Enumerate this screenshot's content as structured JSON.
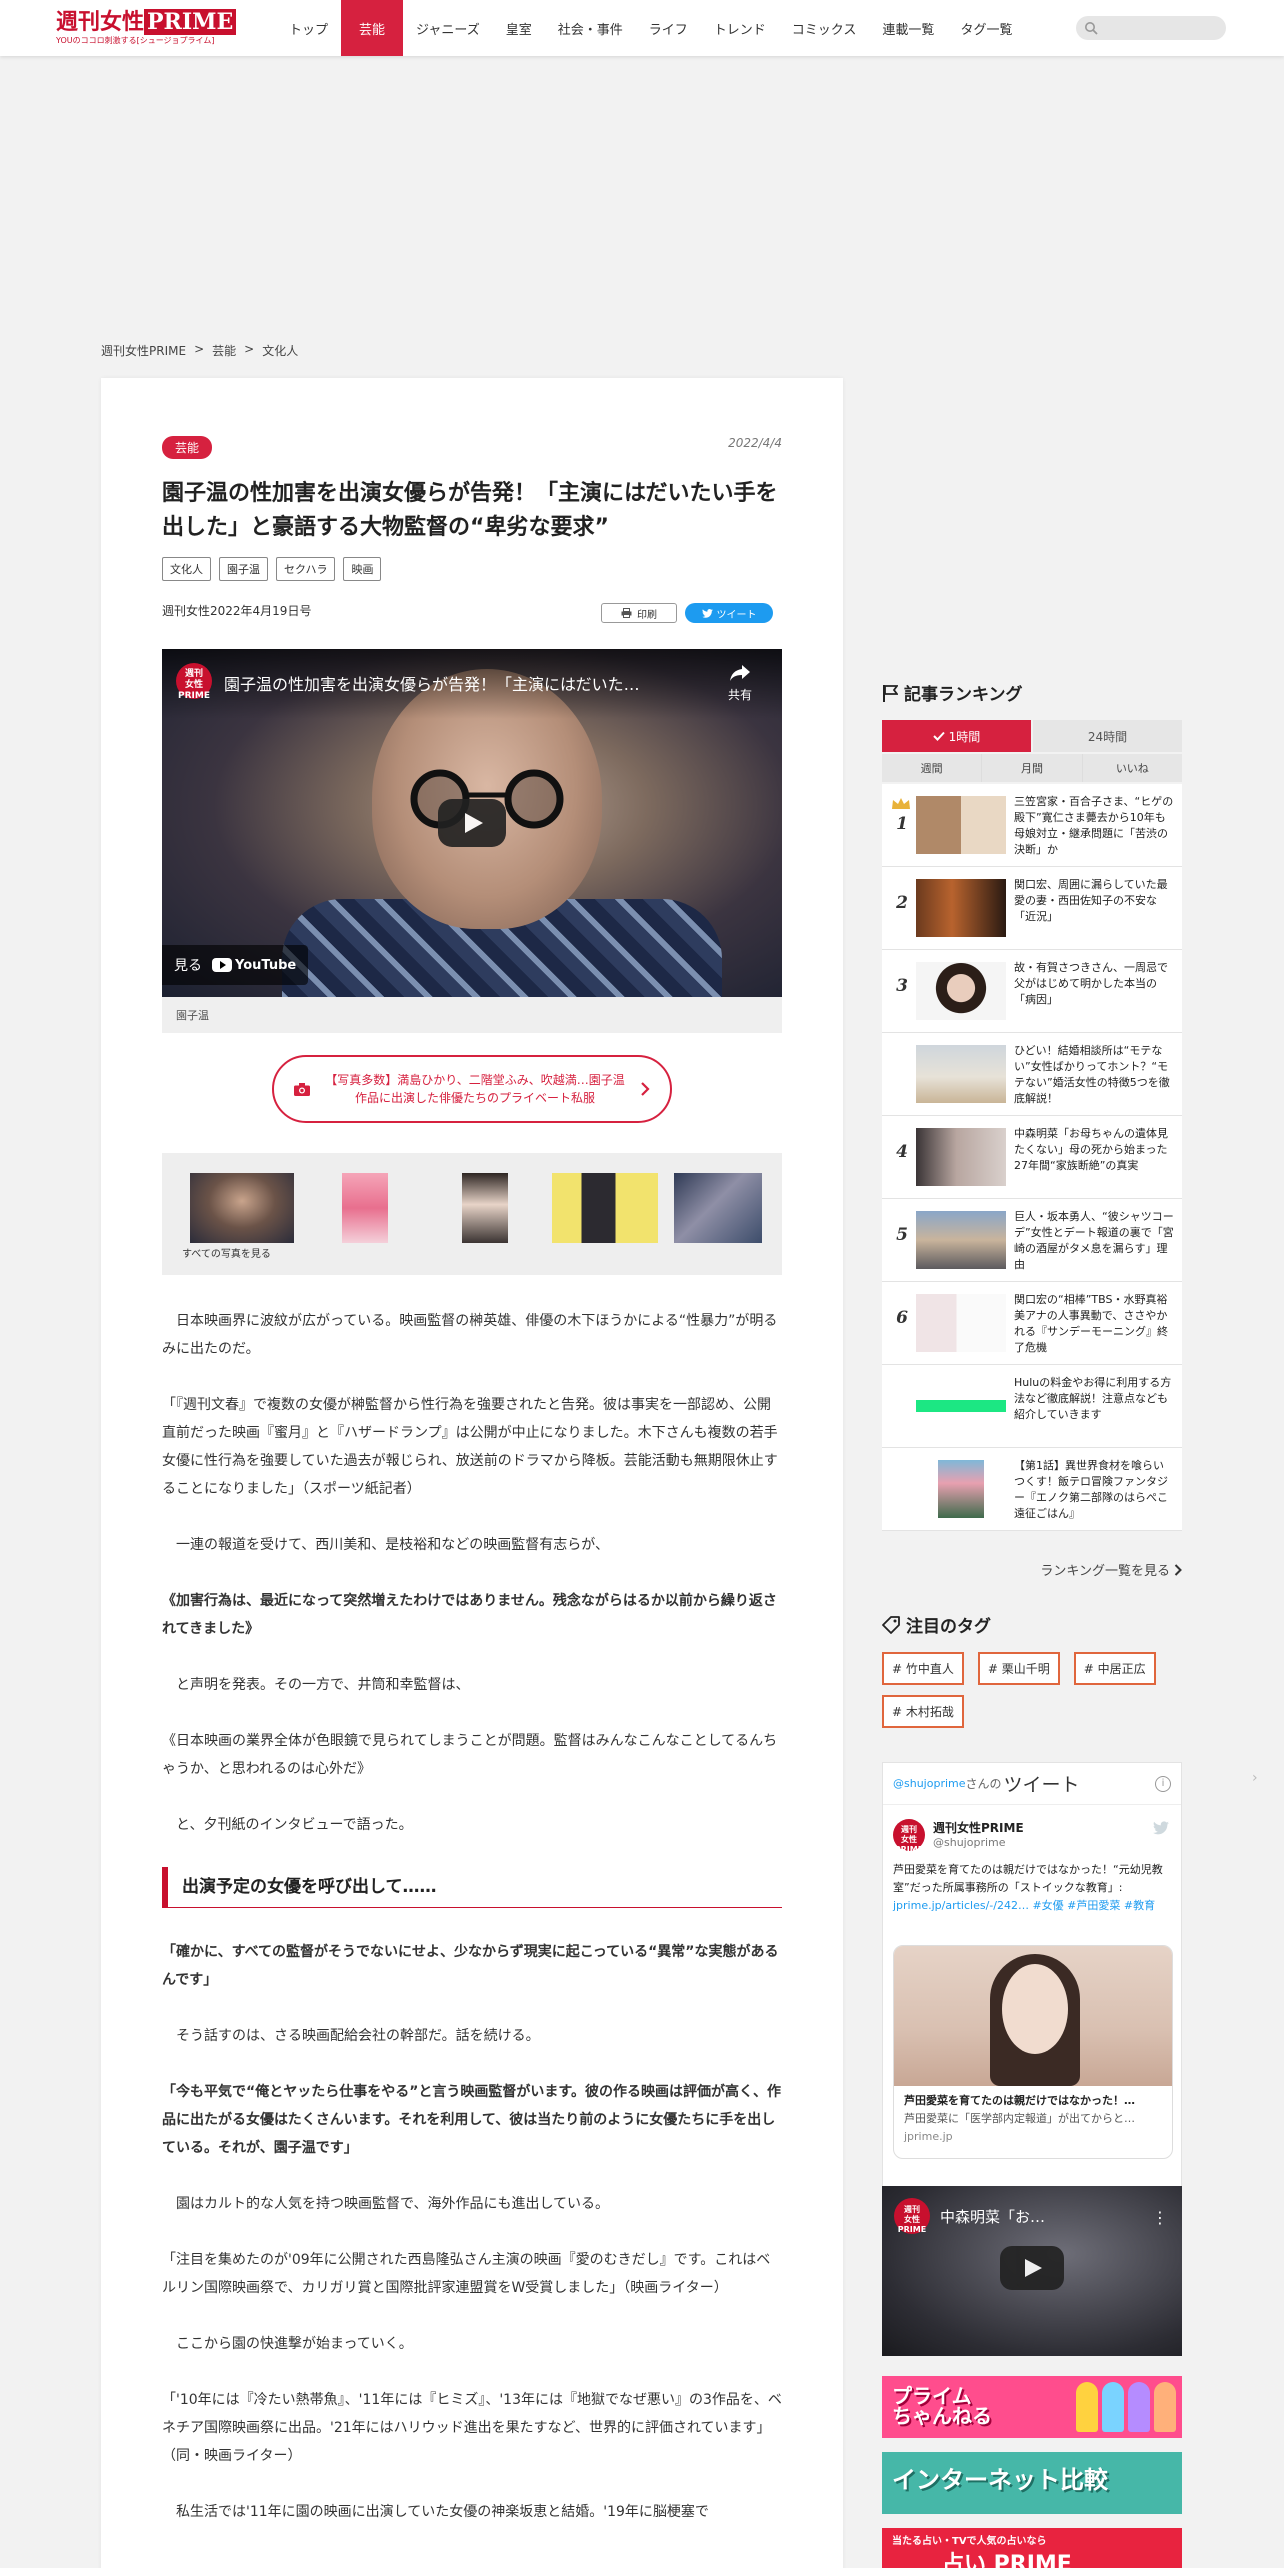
{
  "header": {
    "logo_main_left": "週刊女性",
    "logo_main_right": "PRIME",
    "logo_sub": "YOUのココロ刺激する[シュージョプライム]",
    "nav": [
      "トップ",
      "芸能",
      "ジャニーズ",
      "皇室",
      "社会・事件",
      "ライフ",
      "トレンド",
      "コミックス",
      "連載一覧",
      "タグ一覧"
    ],
    "active_nav": 1,
    "search_placeholder": ""
  },
  "breadcrumb": {
    "items": [
      "週刊女性PRIME",
      "芸能",
      "文化人"
    ],
    "separator": ">"
  },
  "article": {
    "category": "芸能",
    "date": "2022/4/4",
    "title": "園子温の性加害を出演女優らが告発！「主演にはだいたい手を出した」と豪語する大物監督の“卑劣な要求”",
    "tags": [
      "文化人",
      "園子温",
      "セクハラ",
      "映画"
    ],
    "issue": "週刊女性2022年4月19日号",
    "print_label": "印刷",
    "tweet_label": "ツイート",
    "video": {
      "channel": "週刊女性PRIME",
      "title": "園子温の性加害を出演女優らが告発！「主演にはだいた…",
      "share_label": "共有",
      "watch_label": "見る",
      "youtube_label": "YouTube"
    },
    "caption": "園子温",
    "photo_button": "【写真多数】満島ひかり、二階堂ふみ、吹越満…園子温作品に出演した俳優たちのプライベート私服",
    "gallery_label": "すべての写真を見る",
    "paragraphs": [
      {
        "style": "indent",
        "text": "日本映画界に波紋が広がっている。映画監督の榊英雄、俳優の木下ほうかによる“性暴力”が明るみに出たのだ。"
      },
      {
        "style": "normal",
        "text": "「『週刊文春』で複数の女優が榊監督から性行為を強要されたと告発。彼は事実を一部認め、公開直前だった映画『蜜月』と『ハザードランプ』は公開が中止になりました。木下さんも複数の若手女優に性行為を強要していた過去が報じられ、放送前のドラマから降板。芸能活動も無期限休止することになりました」（スポーツ紙記者）"
      },
      {
        "style": "indent",
        "text": "一連の報道を受けて、西川美和、是枝裕和などの映画監督有志らが、"
      },
      {
        "style": "bold",
        "text": "《加害行為は、最近になって突然増えたわけではありません。残念ながらはるか以前から繰り返されてきました》"
      },
      {
        "style": "indent",
        "text": "と声明を発表。その一方で、井筒和幸監督は、"
      },
      {
        "style": "normal",
        "text": "《日本映画の業界全体が色眼鏡で見られてしまうことが問題。監督はみんなこんなことしてるんちゃうか、と思われるのは心外だ》"
      },
      {
        "style": "indent",
        "text": "と、夕刊紙のインタビューで語った。"
      }
    ],
    "heading": "出演予定の女優を呼び出して……",
    "paragraphs2": [
      {
        "style": "bold",
        "text": "「確かに、すべての監督がそうでないにせよ、少なからず現実に起こっている“異常”な実態があるんです」"
      },
      {
        "style": "indent",
        "text": "そう話すのは、さる映画配給会社の幹部だ。話を続ける。"
      },
      {
        "style": "bold",
        "text": "「今も平気で“俺とヤッたら仕事をやる”と言う映画監督がいます。彼の作る映画は評価が高く、作品に出たがる女優はたくさんいます。それを利用して、彼は当たり前のように女優たちに手を出している。それが、園子温です」"
      },
      {
        "style": "indent",
        "text": "園はカルト的な人気を持つ映画監督で、海外作品にも進出している。"
      },
      {
        "style": "normal",
        "text": "「注目を集めたのが'09年に公開された西島隆弘さん主演の映画『愛のむきだし』です。これはベルリン国際映画祭で、カリガリ賞と国際批評家連盟賞をW受賞しました」（映画ライター）"
      },
      {
        "style": "indent",
        "text": "ここから園の快進撃が始まっていく。"
      },
      {
        "style": "normal",
        "text": "「'10年には『冷たい熱帯魚』、'11年には『ヒミズ』、'13年には『地獄でなぜ悪い』の3作品を、ベネチア国際映画祭に出品。'21年にはハリウッド進出を果たすなど、世界的に評価されています」（同・映画ライター）"
      },
      {
        "style": "indent",
        "text": "私生活では'11年に園の映画に出演していた女優の神楽坂恵と結婚。'19年に脳梗塞で"
      }
    ]
  },
  "sidebar": {
    "ranking_title": "記事ランキング",
    "tabs": [
      "1時間",
      "24時間"
    ],
    "active_tab": 0,
    "subtabs": [
      "週間",
      "月間",
      "いいね"
    ],
    "ranking": [
      {
        "num": "1",
        "text": "三笠宮家・百合子さま、“ヒゲの殿下”寛仁さま薨去から10年も母娘対立・継承問題に「苦渋の決断」か"
      },
      {
        "num": "2",
        "text": "関口宏、周囲に漏らしていた最愛の妻・西田佐知子の不安な「近況」"
      },
      {
        "num": "3",
        "text": "故・有賀さつきさん、一周忌で父がはじめて明かした本当の「病因」"
      },
      {
        "num": "",
        "text": "ひどい！結婚相談所は“モテない”女性ばかりってホント？“モテない”婚活女性の特徴5つを徹底解説！"
      },
      {
        "num": "4",
        "text": "中森明菜「お母ちゃんの遺体見たくない」母の死から始まった27年間“家族断絶”の真実"
      },
      {
        "num": "5",
        "text": "巨人・坂本勇人、“彼シャツコーデ”女性とデート報道の裏で「宮崎の酒屋がタメ息を漏らす」理由"
      },
      {
        "num": "6",
        "text": "関口宏の“相棒”TBS・水野真裕美アナの人事異動で、ささやかれる『サンデーモーニング』終了危機"
      },
      {
        "num": "",
        "text": "Huluの料金やお得に利用する方法など徹底解説！注意点なども紹介していきます"
      },
      {
        "num": "",
        "text": "【第1話】異世界食材を喰らいつくす！飯テロ冒険ファンタジー『エノク第二部隊のはらぺこ遠征ごはん』"
      }
    ],
    "ranking_more": "ランキング一覧を見る",
    "tags_title": "注目のタグ",
    "tags": [
      "# 竹中直人",
      "# 栗山千明",
      "# 中居正広",
      "# 木村拓哉"
    ],
    "twitter": {
      "handle": "@shujoprime",
      "handle_suffix": "さんの",
      "title": "ツイート",
      "account_name": "週刊女性PRIME",
      "account_handle": "@shujoprime",
      "text": "芦田愛菜を育てたのは親だけではなかった！“元幼児教室”だった所属事務所の「ストイックな教育」",
      "link": "jprime.jp/articles/-/242…",
      "hashtags": "#女優 #芦田愛菜 #教育",
      "card_title": "芦田愛菜を育てたのは親だけではなかった！…",
      "card_desc": "芦田愛菜に「医学部内定報道」が出てからと…",
      "card_domain": "jprime.jp"
    },
    "side_video_title": "中森明菜「お…",
    "banner1": "プライム\nちゃんねる",
    "banner2": "インターネット比較",
    "banner3_small": "当たる占い・TVで人気の占いなら",
    "banner3_big": "占い PRIME"
  },
  "colors": {
    "accent": "#d6213f",
    "tag_border": "#e0663d",
    "twitter": "#1d9bf0"
  }
}
